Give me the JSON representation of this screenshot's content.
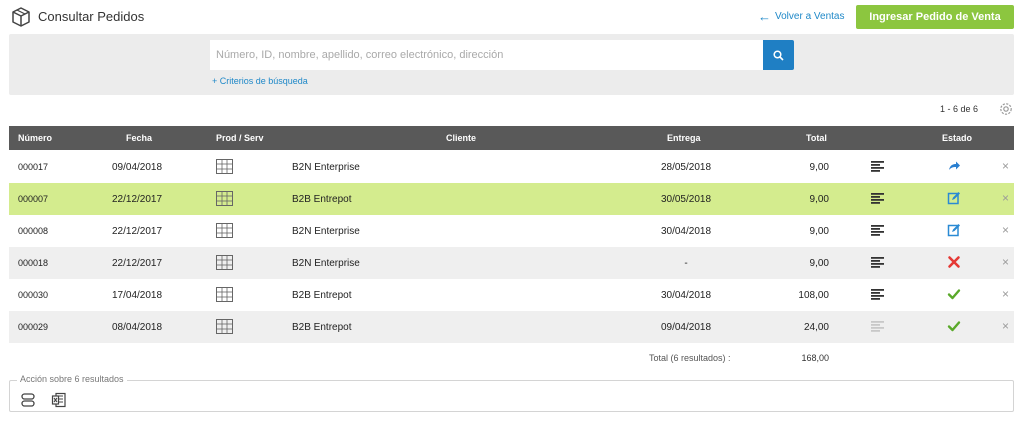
{
  "header": {
    "icon": "box-icon",
    "title": "Consultar Pedidos",
    "back_link": "Volver a Ventas",
    "new_order_button": "Ingresar Pedido de Venta"
  },
  "search": {
    "placeholder": "Número, ID, nombre, apellido, correo electrónico, dirección",
    "value": "",
    "criteria_link": "+ Criterios de búsqueda"
  },
  "pager": "1 - 6 de 6",
  "table": {
    "columns": [
      "Número",
      "Fecha",
      "Prod / Serv",
      "Cliente",
      "Entrega",
      "Total",
      "Estado"
    ],
    "rows": [
      {
        "number": "000017",
        "date": "09/04/2018",
        "client": "B2N Enterprise",
        "delivery": "28/05/2018",
        "total": "9,00",
        "status": "sent"
      },
      {
        "number": "000007",
        "date": "22/12/2017",
        "client": "B2B Entrepot",
        "delivery": "30/05/2018",
        "total": "9,00",
        "status": "edit"
      },
      {
        "number": "000008",
        "date": "22/12/2017",
        "client": "B2N Enterprise",
        "delivery": "30/04/2018",
        "total": "9,00",
        "status": "edit"
      },
      {
        "number": "000018",
        "date": "22/12/2017",
        "client": "B2N Enterprise",
        "delivery": "-",
        "total": "9,00",
        "status": "cancelled"
      },
      {
        "number": "000030",
        "date": "17/04/2018",
        "client": "B2B Entrepot",
        "delivery": "30/04/2018",
        "total": "108,00",
        "status": "done"
      },
      {
        "number": "000029",
        "date": "08/04/2018",
        "client": "B2B Entrepot",
        "delivery": "09/04/2018",
        "total": "24,00",
        "status": "done"
      }
    ],
    "total_label": "Total (6 resultados) :",
    "total_value": "168,00"
  },
  "actions": {
    "legend": "Acción sobre 6 resultados"
  },
  "colors": {
    "accent_green": "#8cc63f",
    "selected_row": "#d4ec8e",
    "link_blue": "#1e88c8",
    "header_dark": "#595959"
  }
}
